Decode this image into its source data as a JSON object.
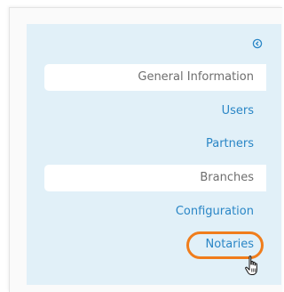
{
  "sidebar": {
    "collapse_icon": "chevron-left-circle-icon",
    "items": [
      {
        "label": "General Information",
        "style": "white"
      },
      {
        "label": "Users",
        "style": "link"
      },
      {
        "label": "Partners",
        "style": "link"
      },
      {
        "label": "Branches",
        "style": "white"
      },
      {
        "label": "Configuration",
        "style": "link"
      },
      {
        "label": "Notaries",
        "style": "link",
        "highlighted": true
      }
    ]
  },
  "cursor": "hand-pointer-icon",
  "colors": {
    "panel_background": "#e1f0f8",
    "link": "#2a86c6",
    "active_item_text": "#6e6e6e",
    "highlight_ring": "#f07d1c"
  }
}
